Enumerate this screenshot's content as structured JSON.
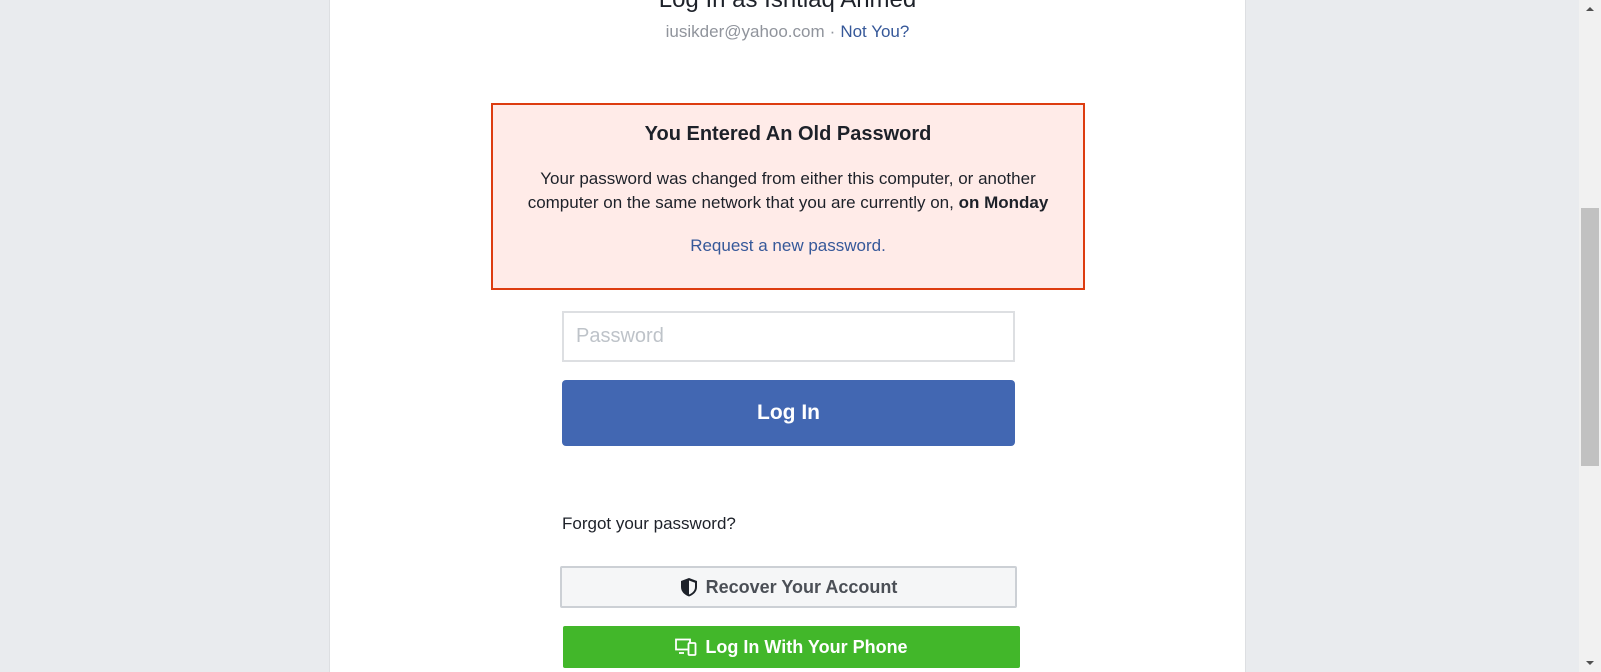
{
  "header": {
    "title": "Log In as Ishtiaq Ahmed",
    "email": "iusikder@yahoo.com",
    "separator": "·",
    "not_you_link": "Not You?"
  },
  "alert": {
    "title": "You Entered An Old Password",
    "message": "Your password was changed from either this computer, or another computer on the same network that you are currently on,",
    "message_emphasis": "on Monday",
    "link": "Request a new password."
  },
  "form": {
    "password_placeholder": "Password",
    "password_value": "",
    "login_label": "Log In",
    "forgot_link": "Forgot your password?",
    "recover_label": "Recover Your Account",
    "phone_label": "Log In With Your Phone"
  },
  "icons": {
    "recover": "shield-icon",
    "phone": "device-icon",
    "scroll_up": "scroll-up-arrow-icon",
    "scroll_down": "scroll-down-arrow-icon"
  },
  "colors": {
    "brand_blue": "#4267b2",
    "link_blue": "#365899",
    "alert_border": "#dd3c10",
    "alert_bg": "#ffebe8",
    "green": "#42b72a",
    "page_bg": "#e9ebee"
  }
}
